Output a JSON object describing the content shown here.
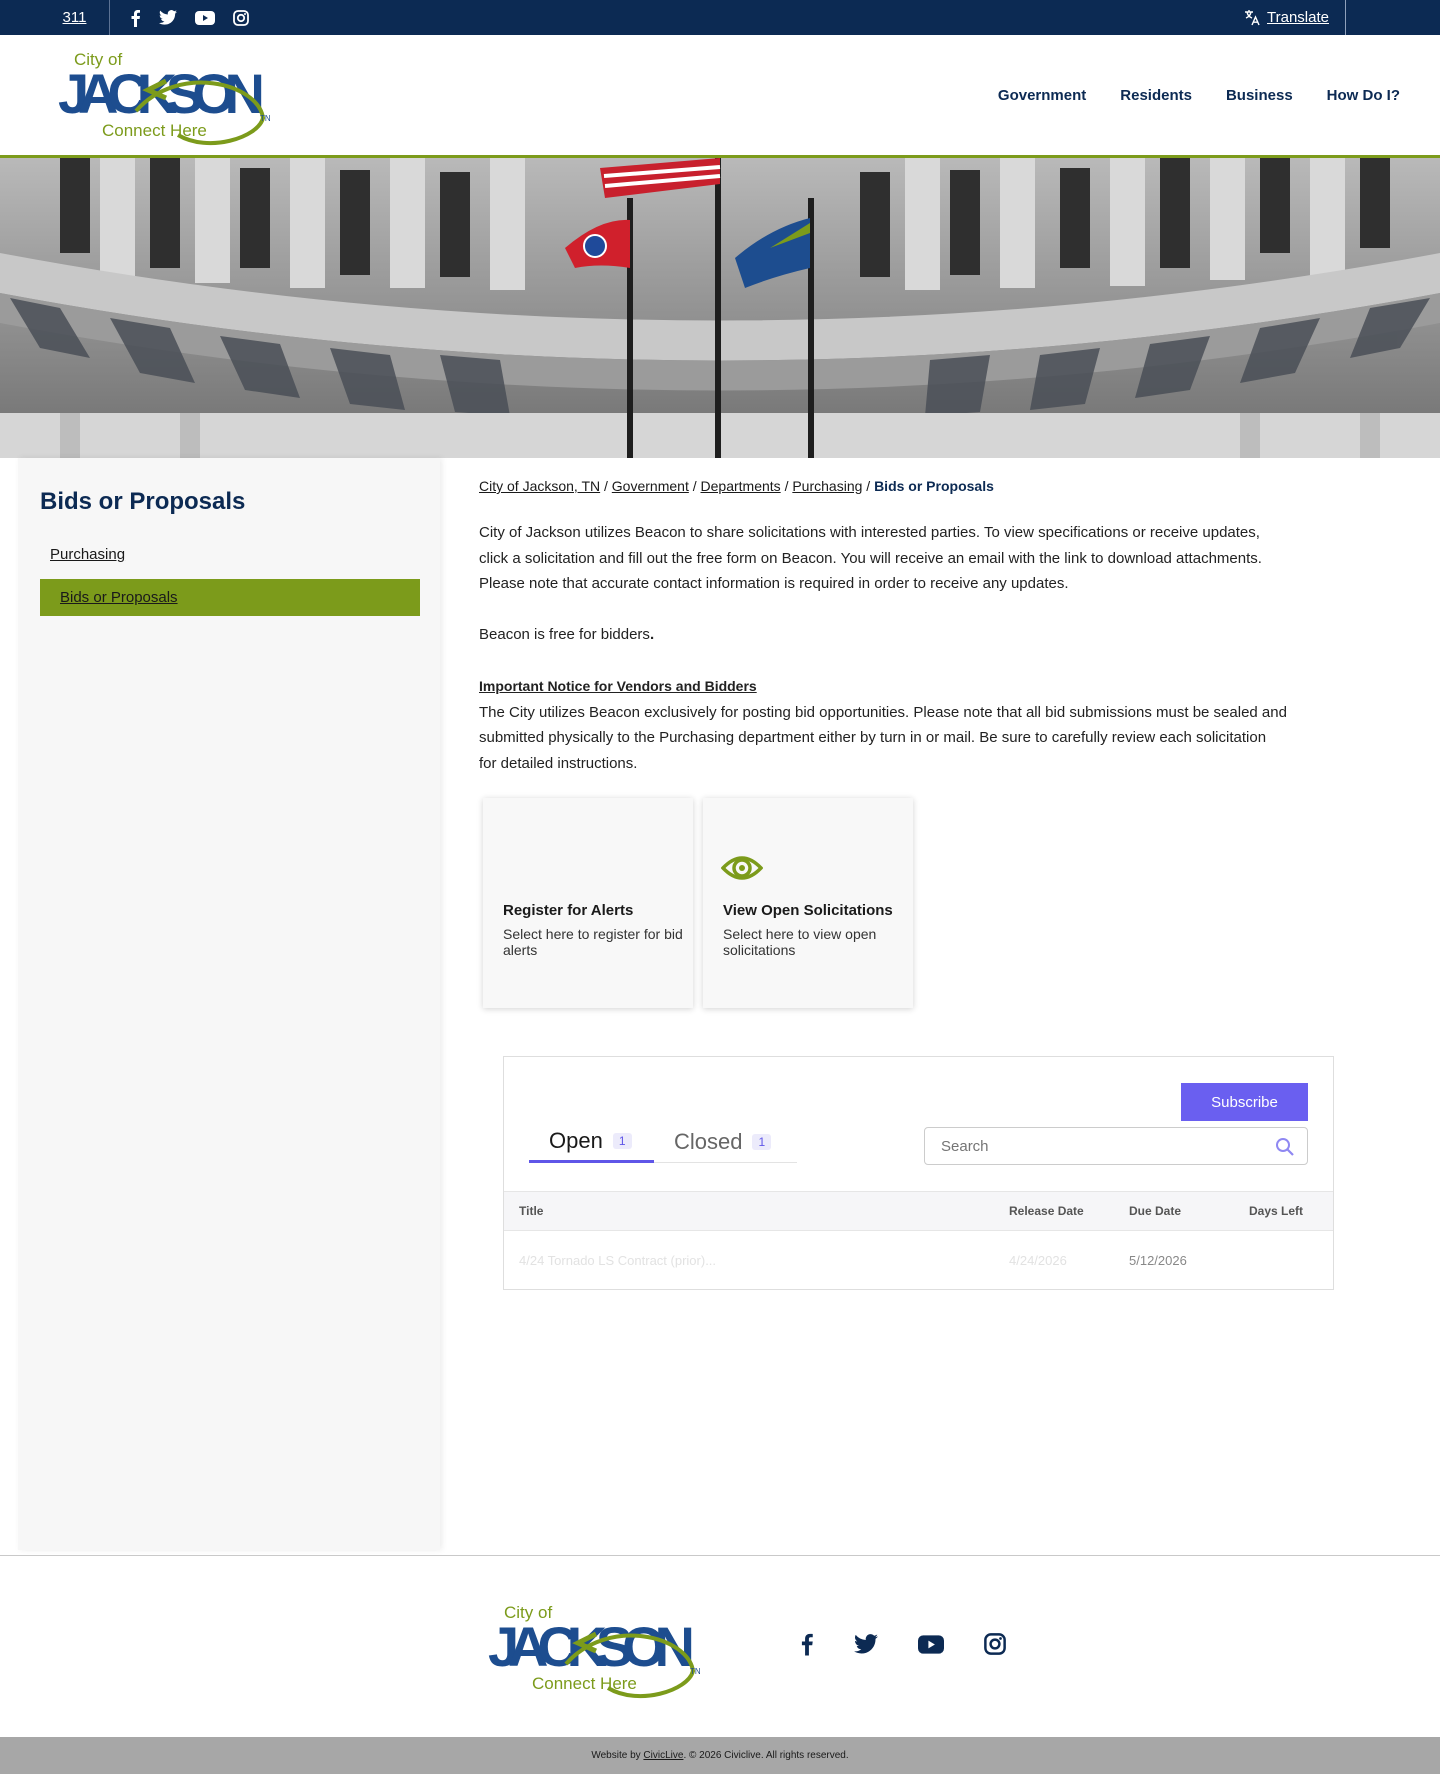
{
  "topbar": {
    "phone_label": "311",
    "translate_label": "Translate"
  },
  "logo": {
    "city_of": "City of",
    "jackson": "JACKSON",
    "tagline": "Connect Here",
    "state": "TN"
  },
  "nav": {
    "items": [
      "Government",
      "Residents",
      "Business",
      "How Do I?"
    ]
  },
  "sidebar": {
    "title": "Bids or Proposals",
    "items": [
      {
        "label": "Purchasing",
        "active": false
      },
      {
        "label": "Bids or Proposals",
        "active": true
      }
    ]
  },
  "breadcrumb": {
    "items": [
      "City of Jackson, TN",
      "Government",
      "Departments",
      "Purchasing"
    ],
    "current": "Bids or Proposals",
    "separator": "/"
  },
  "content": {
    "intro_1": "City of Jackson utilizes Beacon to share solicitations with interested parties. To view specifications or receive updates,",
    "intro_2": "click a solicitation and fill out the free form on Beacon. You will receive an email with the link to download attachments.",
    "intro_3": "Please note that accurate contact information is required in order to receive any updates.",
    "free_note": "Beacon is free for bidders",
    "free_note_period": ".",
    "notice_heading": "Important Notice for Vendors and Bidders",
    "notice_1": "The City utilizes Beacon exclusively for posting bid opportunities.  Please note that all bid submissions must be sealed and",
    "notice_2": "submitted physically to the Purchasing department either by turn in or mail.  Be sure to carefully review each solicitation",
    "notice_3": "for detailed instructions."
  },
  "cards": [
    {
      "title": "Register for Alerts",
      "desc": "Select here to register for bid alerts",
      "icon": "none"
    },
    {
      "title": "View Open Solicitations",
      "desc": "Select here to view open solicitations",
      "icon": "eye-icon"
    }
  ],
  "widget": {
    "subscribe_label": "Subscribe",
    "tabs": [
      {
        "label": "Open",
        "count": "1"
      },
      {
        "label": "Closed",
        "count": "1"
      }
    ],
    "search_placeholder": "Search",
    "columns": [
      "Title",
      "Release Date",
      "Due Date",
      "Days Left"
    ],
    "rows": [
      {
        "title": "4/24 Tornado LS Contract (prior)...",
        "release": "4/24/2026",
        "due": "5/12/2026",
        "days_left": ""
      }
    ],
    "accent_color": "#6a5ff0"
  },
  "footer": {
    "credit_prefix": "Website by ",
    "credit_link": "CivicLive",
    "credit_suffix": ". © 2026 Civiclive. All rights reserved."
  },
  "colors": {
    "navy": "#0c2a53",
    "green": "#7c9b1b"
  }
}
